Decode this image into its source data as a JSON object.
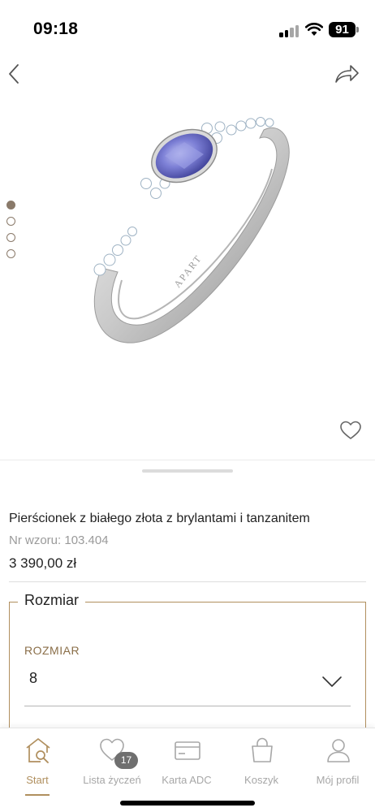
{
  "status_bar": {
    "time": "09:18",
    "battery": "91",
    "icons": [
      "signal-icon",
      "wifi-icon",
      "battery-icon"
    ]
  },
  "nav": {
    "back_icon": "chevron-left-icon",
    "share_icon": "share-arrow-icon"
  },
  "gallery": {
    "image_count": 4,
    "active_index": 0,
    "image_alt": "APART"
  },
  "product": {
    "title": "Pierścionek z białego złota z brylantami i tanzanitem",
    "sku_label": "Nr wzoru:",
    "sku_value": "103.404",
    "price": "3 390,00 zł"
  },
  "size": {
    "legend": "Rozmiar",
    "label": "ROZMIAR",
    "selected": "8"
  },
  "tabs": [
    {
      "label": "Start",
      "icon": "home-search-icon",
      "active": true
    },
    {
      "label": "Lista życzeń",
      "icon": "heart-icon",
      "badge": "17"
    },
    {
      "label": "Karta ADC",
      "icon": "card-icon"
    },
    {
      "label": "Koszyk",
      "icon": "shopping-bag-icon"
    },
    {
      "label": "Mój profil",
      "icon": "user-icon"
    }
  ],
  "colors": {
    "accent": "#b08f5e",
    "inactive": "#a7a7a7",
    "dot": "#8a7a6a",
    "badge": "#6f6f6f"
  }
}
